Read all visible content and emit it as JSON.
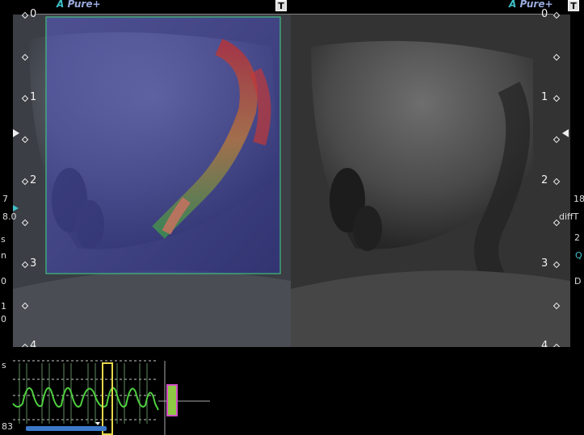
{
  "header": {
    "brand_left": "Pure",
    "brand_right": "Pure",
    "t_marker_left": "T",
    "t_marker_right": "T"
  },
  "depth_scale": {
    "left_labels": [
      "0",
      "1",
      "2",
      "3",
      "4"
    ],
    "right_labels": [
      "0",
      "1",
      "2",
      "3",
      "4"
    ]
  },
  "left_margin": {
    "values": [
      "7",
      "8.0",
      "s",
      "n",
      "0",
      "1",
      "0"
    ],
    "sweep_label": "s",
    "bottom_value": "83"
  },
  "right_margin": {
    "values": [
      "18",
      "diffT",
      "2",
      "Q",
      "D"
    ]
  },
  "waveform": {
    "cycles_visible": 6
  },
  "colors": {
    "roi_border": "#3fbf7f",
    "cine_bar": "#3b78c8",
    "marker_yellow": "#e8d84a",
    "marker_green": "#8ec844",
    "marker_magenta": "#d24fc8"
  }
}
